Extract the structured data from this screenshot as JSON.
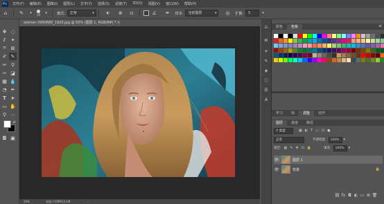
{
  "app": {
    "logo": "Ps"
  },
  "menu": [
    "文件(F)",
    "编辑(E)",
    "图像(I)",
    "图层(L)",
    "文字(Y)",
    "选择(S)",
    "滤镜(T)",
    "3D(D)",
    "视图(V)",
    "窗口(W)",
    "帮助(H)"
  ],
  "options": {
    "brush_size": "19",
    "mode_label": "模式:",
    "mode_value": "正常",
    "sample_label": "样本:",
    "sample_value": "当前图层",
    "spread_label": "扩散:",
    "spread_value": "5"
  },
  "document": {
    "tab_title": "woman-3990680_1920.jpg @ 50% (图层 1, RGB/8#) *",
    "close_glyph": "×",
    "zoom": "50%",
    "doc_info": "文档:7.03M/14.1M"
  },
  "swatch_panel": {
    "tabs": [
      "颜色",
      "色板"
    ],
    "active": 1
  },
  "layers_panel": {
    "tabs": [
      "学习",
      "库",
      "调整",
      "动作"
    ],
    "active_tab": 2,
    "subtabs": [
      "图层",
      "通道",
      "路径"
    ],
    "filter_label": "类型",
    "blend_mode": "正常",
    "opacity_label": "不透明度:",
    "opacity_value": "100%",
    "lock_label": "锁定:",
    "fill_label": "填充:",
    "fill_value": "100%",
    "layers": [
      {
        "name": "图层 1",
        "selected": true,
        "locked": false
      },
      {
        "name": "背景",
        "selected": false,
        "locked": true
      }
    ]
  },
  "colors": {
    "menubar": "#424242",
    "workspace": "#282828",
    "panel": "#535353",
    "accent_selected": "#6a6a6a",
    "foreground": "#ffffff",
    "background": "#000000"
  },
  "swatches": [
    [
      "#ffffff",
      "#000000",
      "#ffffff",
      "#000000",
      "#e0e0e0",
      "#ff0000",
      "#ffff00",
      "#00ff00",
      "#00ffff",
      "#0000ff",
      "#ff00ff",
      "#ff7f7f",
      "#ffff7f",
      "#7fff7f",
      "#7fffff",
      "#7f7fff",
      "#ff7fff",
      "#ff8c1a",
      "#c8c8c8",
      "#a0a0a0",
      "#707070",
      "#505050",
      "#303030",
      "#ffd0d0"
    ],
    [
      "#ed1c24",
      "#f26522",
      "#f7941d",
      "#fff200",
      "#8dc63f",
      "#39b54a",
      "#00a651",
      "#00a99d",
      "#00aeef",
      "#0072bc",
      "#0054a6",
      "#2e3192",
      "#662d91",
      "#92278f",
      "#ec008c",
      "#ed145b",
      "#f7977a",
      "#fbad82",
      "#fdc68c",
      "#fff799",
      "#c4df9b",
      "#a3d39c",
      "#82ca9c",
      "#7bcdc8"
    ],
    [
      "#6dcff6",
      "#7da7d9",
      "#8393ca",
      "#8781bd",
      "#a186be",
      "#bd8cbf",
      "#f49ac1",
      "#f5989d",
      "#f26c4f",
      "#f68e55",
      "#fbaf5d",
      "#fff467",
      "#acd372",
      "#7cc576",
      "#3bb878",
      "#1abbb4",
      "#00bff3",
      "#438ccb",
      "#5574b9",
      "#605ca8",
      "#855fa8",
      "#a763a8",
      "#f06ea9",
      "#f26d7d"
    ],
    [
      "#9e0b0f",
      "#a0410d",
      "#a36209",
      "#aba000",
      "#598527",
      "#1a7b30",
      "#007236",
      "#00746b",
      "#0076a3",
      "#004b80",
      "#003471",
      "#1b1464",
      "#440e62",
      "#630460",
      "#9e005d",
      "#9e0039",
      "#790000",
      "#7b2e00",
      "#7d4900",
      "#827b00",
      "#406618",
      "#005e20",
      "#005826",
      "#005952"
    ],
    [
      "#005b7f",
      "#003663",
      "#002157",
      "#0d004c",
      "#32004b",
      "#4b0049",
      "#7b0046",
      "#7a0026",
      "#c7b299",
      "#998675",
      "#736357",
      "#534741",
      "#37302a",
      "#c69c6d",
      "#a67c52",
      "#8c6239",
      "#754c24",
      "#603913",
      "#ff0000",
      "#cc0000",
      "#990000",
      "#660000",
      "#ff6600",
      "#cc5200"
    ],
    [
      "#ffcc00",
      "#ccff00",
      "#66ff00",
      "#00ff66",
      "#00ffcc",
      "#00ccff",
      "#0066ff",
      "#3300ff",
      "#9900ff",
      "#ff00cc",
      "#ff0066",
      "#8b4513",
      "#d2691e",
      "#cd853f",
      "#deb887",
      "#f5deb3",
      "#2f4f4f",
      "#696969",
      "#808000",
      "#556b2f",
      "#6b8e23",
      "#9acd32",
      "#228b22",
      "#006400"
    ]
  ]
}
